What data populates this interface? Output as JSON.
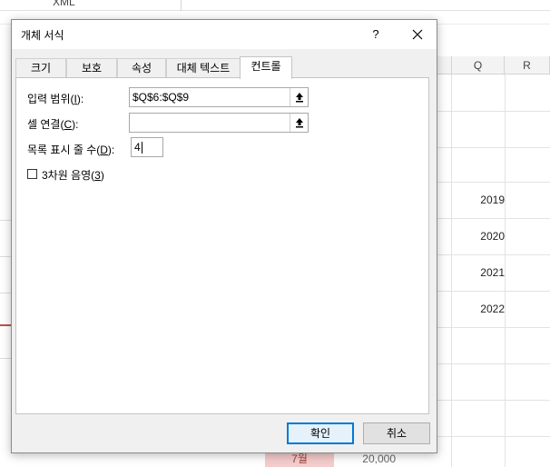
{
  "sheet": {
    "topbar_text": "XML",
    "columns": [
      "Q",
      "R"
    ],
    "years": [
      "2019",
      "2020",
      "2021",
      "2022"
    ],
    "bottom_row": {
      "month": "7월",
      "value": "20,000"
    }
  },
  "dialog": {
    "title": "개체 서식",
    "help_label": "?",
    "tabs": [
      {
        "label": "크기"
      },
      {
        "label": "보호"
      },
      {
        "label": "속성"
      },
      {
        "label": "대체 텍스트"
      },
      {
        "label": "컨트롤"
      }
    ],
    "active_tab": "컨트롤",
    "input_range": {
      "label": "입력 범위(",
      "accel": "I",
      "suffix": "):",
      "value": "$Q$6:$Q$9"
    },
    "cell_link": {
      "label": "셀 연결(",
      "accel": "C",
      "suffix": "):",
      "value": ""
    },
    "drop_lines": {
      "label": "목록 표시 줄 수(",
      "accel": "D",
      "suffix": "):",
      "value": "4"
    },
    "shading": {
      "label": "3차원 음영(",
      "accel": "3",
      "suffix": ")",
      "checked": false
    },
    "ok_label": "확인",
    "cancel_label": "취소"
  },
  "icons": [
    "help-icon",
    "close-icon",
    "range-picker-icon"
  ],
  "colors": {
    "primary_border": "#0078d7",
    "panel_bg": "#ffffff",
    "dialog_bg": "#f0f0f0"
  }
}
